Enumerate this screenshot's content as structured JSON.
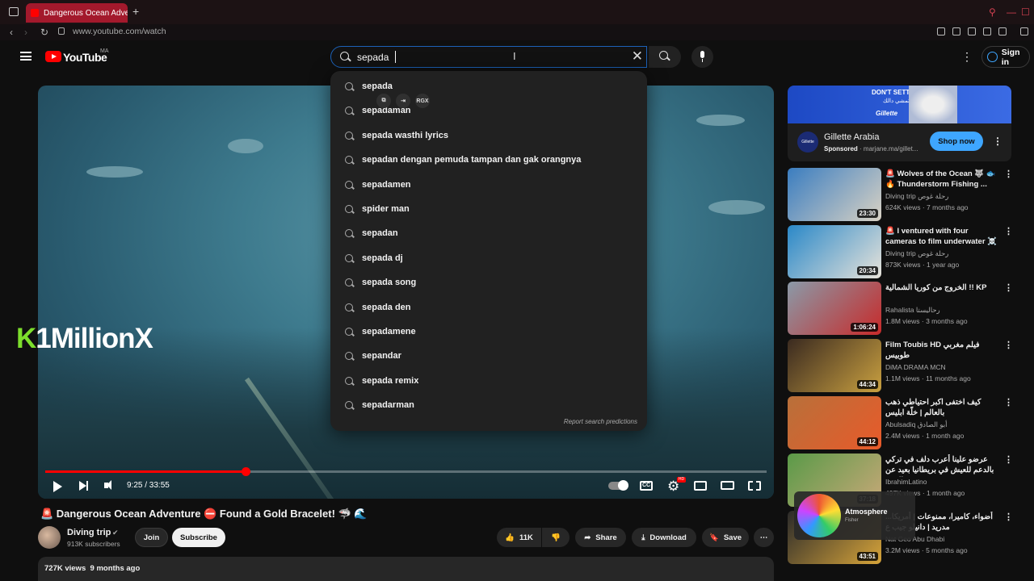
{
  "browser": {
    "tab_title": "Dangerous Ocean Adve",
    "url": "www.youtube.com/watch"
  },
  "header": {
    "logo_text": "YouTube",
    "country_code": "MA",
    "search_value": "sepada",
    "sign_in_label": "Sign in"
  },
  "suggestions": [
    "sepada",
    "sepadaman",
    "sepada wasthi lyrics",
    "sepadan dengan pemuda tampan dan gak orangnya",
    "sepadamen",
    "spider man",
    "sepadan",
    "sepada dj",
    "sepada song",
    "sepada den",
    "sepadamene",
    "sepandar",
    "sepada remix",
    "sepadarman"
  ],
  "report_predictions": "Report search predictions",
  "mini_tools": {
    "rgx": "RGX"
  },
  "player": {
    "time": "9:25 / 33:55",
    "progress_fraction": 0.278,
    "watermark_k": "K",
    "watermark_text": "1MillionX",
    "cc_label": "CC",
    "hd_label": "HD"
  },
  "video": {
    "title": "🚨 Dangerous Ocean Adventure ⛔ Found a Gold Bracelet! 🦈 🌊",
    "channel": "Diving trip",
    "subscribers": "913K subscribers",
    "join_label": "Join",
    "subscribe_label": "Subscribe",
    "likes": "11K",
    "share_label": "Share",
    "download_label": "Download",
    "save_label": "Save",
    "views": "727K views",
    "age": "9 months ago"
  },
  "ad": {
    "banner_line1": "DON'T SETTLE,",
    "banner_line2": "لا تمشي دالك",
    "banner_brand": "Gillette",
    "name": "Gillette Arabia",
    "sponsored": "Sponsored",
    "domain": "· marjane.ma/gillet...",
    "cta": "Shop now",
    "logo_text": "Gillette"
  },
  "recommendations": [
    {
      "title": "🚨 Wolves of the Ocean 🐺 🐟 🔥 Thunderstorm Fishing ...",
      "channel": "Diving trip رحلة غوص",
      "meta": "624K views · 7 months ago",
      "duration": "23:30",
      "color1": "#3a7dc0",
      "color2": "#d9d2c4"
    },
    {
      "title": "🚨 I ventured with four cameras to film underwater ☠️ but I los...",
      "channel": "Diving trip رحلة غوص",
      "meta": "873K views · 1 year ago",
      "duration": "20:34",
      "color1": "#2a88c8",
      "color2": "#e8e3da"
    },
    {
      "title": "الخروج من كوريا الشمالية !! KP",
      "channel": "Rahalista رحاليستا",
      "meta": "1.8M views · 3 months ago",
      "duration": "1:06:24",
      "color1": "#8a9aa8",
      "color2": "#c72a2a"
    },
    {
      "title": "Film Toubis HD فيلم مغربي طوبيس",
      "channel": "DiMA DRAMA MCN",
      "meta": "1.1M views · 11 months ago",
      "duration": "44:34",
      "color1": "#3a2a20",
      "color2": "#c9a040"
    },
    {
      "title": "كيف اختفى اكبر احتياطي ذهب بالعالم | خلّة ابليس",
      "channel": "Abulsadiq أبو الصادق",
      "meta": "2.4M views · 1 month ago",
      "duration": "44:12",
      "color1": "#b8703a",
      "color2": "#e85a2a"
    },
    {
      "title": "عرضو علينا أعرب دلف في تركي بالدعم للعيش في بريطانيا بعيد عن البشر BO",
      "channel": "IbrahimLatino",
      "meta": "497K views · 1 month ago",
      "duration": "37:18",
      "color1": "#5a9a48",
      "color2": "#c8a878"
    },
    {
      "title": "أضواء، كاميرا، ممنوعات | أمريكا... مدريد | دانيلو جيب ع",
      "channel": "Nat Geo Abu Dhabi",
      "meta": "3.2M views · 5 months ago",
      "duration": "43:51",
      "color1": "#2a2a2a",
      "color2": "#d7a43a"
    }
  ],
  "mini_player": {
    "title": "Atmosphere",
    "artist": "Fisher"
  }
}
